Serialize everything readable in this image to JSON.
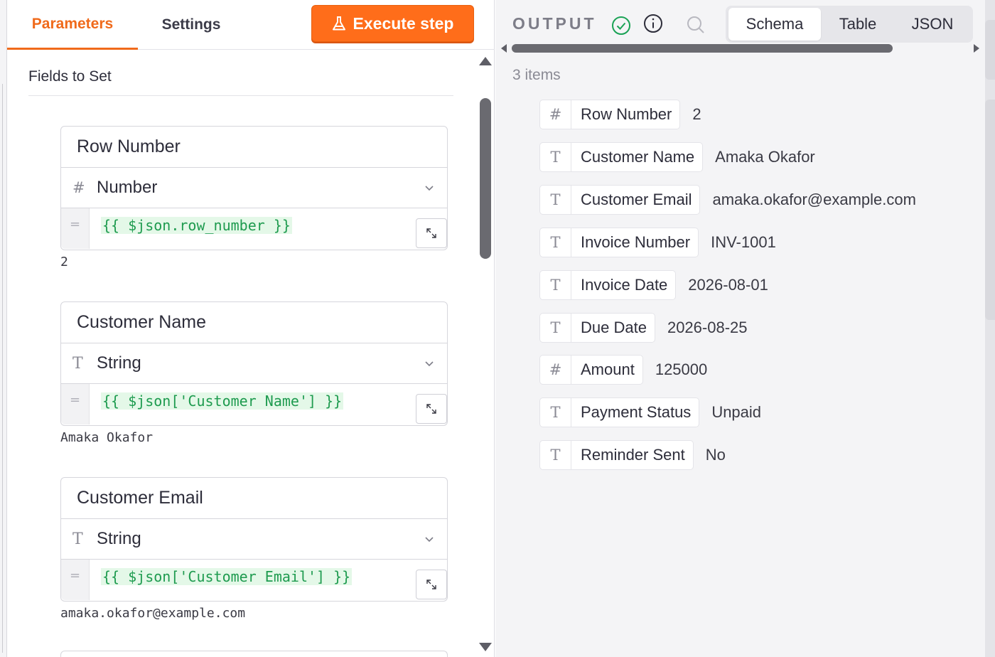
{
  "left_panel": {
    "tabs": [
      {
        "label": "Parameters",
        "active": true
      },
      {
        "label": "Settings",
        "active": false
      }
    ],
    "execute_label": "Execute step",
    "section_title": "Fields to Set",
    "fields": [
      {
        "name": "Row Number",
        "type_icon": "hash-icon",
        "type": "Number",
        "expression": "{{ $json.row_number }}",
        "result": "2"
      },
      {
        "name": "Customer Name",
        "type_icon": "text-type-icon",
        "type": "String",
        "expression": "{{ $json['Customer Name'] }}",
        "result": "Amaka Okafor"
      },
      {
        "name": "Customer Email",
        "type_icon": "text-type-icon",
        "type": "String",
        "expression": "{{ $json['Customer Email'] }}",
        "result": "amaka.okafor@example.com"
      }
    ]
  },
  "output_panel": {
    "title": "OUTPUT",
    "status_icon": "check-circle-icon",
    "views": [
      "Schema",
      "Table",
      "JSON"
    ],
    "active_view": "Schema",
    "items_count": "3 items",
    "schema": [
      {
        "icon": "hash-icon",
        "key": "Row Number",
        "value": "2"
      },
      {
        "icon": "text-type-icon",
        "key": "Customer Name",
        "value": "Amaka Okafor"
      },
      {
        "icon": "text-type-icon",
        "key": "Customer Email",
        "value": "amaka.okafor@example.com"
      },
      {
        "icon": "text-type-icon",
        "key": "Invoice Number",
        "value": "INV-1001"
      },
      {
        "icon": "text-type-icon",
        "key": "Invoice Date",
        "value": "2026-08-01"
      },
      {
        "icon": "text-type-icon",
        "key": "Due Date",
        "value": "2026-08-25"
      },
      {
        "icon": "hash-icon",
        "key": "Amount",
        "value": "125000"
      },
      {
        "icon": "text-type-icon",
        "key": "Payment Status",
        "value": "Unpaid"
      },
      {
        "icon": "text-type-icon",
        "key": "Reminder Sent",
        "value": "No"
      }
    ]
  },
  "colors": {
    "accent": "#ff6d1a",
    "success": "#1aa255",
    "expression_text": "#1e9b4f",
    "expression_bg": "#e4f8e8"
  }
}
